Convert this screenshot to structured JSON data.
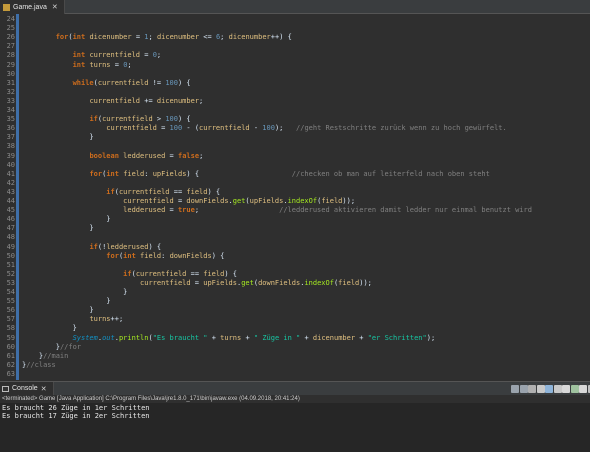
{
  "editor": {
    "tab_label": "Game.java",
    "close_glyph": "✕",
    "lines": [
      {
        "n": "24",
        "t": []
      },
      {
        "n": "25",
        "t": []
      },
      {
        "n": "26",
        "t": [
          [
            "",
            "        "
          ],
          [
            "k",
            "for"
          ],
          [
            "",
            "("
          ],
          [
            "k",
            "int"
          ],
          [
            "",
            " "
          ],
          [
            "v",
            "dicenumber"
          ],
          [
            "",
            " = "
          ],
          [
            "n",
            "1"
          ],
          [
            "",
            "; "
          ],
          [
            "v",
            "dicenumber"
          ],
          [
            "",
            " <= "
          ],
          [
            "n",
            "6"
          ],
          [
            "",
            "; "
          ],
          [
            "v",
            "dicenumber"
          ],
          [
            "",
            "++) {"
          ]
        ]
      },
      {
        "n": "27",
        "t": []
      },
      {
        "n": "28",
        "t": [
          [
            "",
            "            "
          ],
          [
            "k",
            "int"
          ],
          [
            "",
            " "
          ],
          [
            "v",
            "currentfield"
          ],
          [
            "",
            " = "
          ],
          [
            "n",
            "0"
          ],
          [
            "",
            ";"
          ]
        ]
      },
      {
        "n": "29",
        "t": [
          [
            "",
            "            "
          ],
          [
            "k",
            "int"
          ],
          [
            "",
            " "
          ],
          [
            "v",
            "turns"
          ],
          [
            "",
            " = "
          ],
          [
            "n",
            "0"
          ],
          [
            "",
            ";"
          ]
        ]
      },
      {
        "n": "30",
        "t": []
      },
      {
        "n": "31",
        "t": [
          [
            "",
            "            "
          ],
          [
            "k",
            "while"
          ],
          [
            "",
            "("
          ],
          [
            "v",
            "currentfield"
          ],
          [
            "",
            " != "
          ],
          [
            "n",
            "100"
          ],
          [
            "",
            ") {"
          ]
        ]
      },
      {
        "n": "32",
        "t": []
      },
      {
        "n": "33",
        "t": [
          [
            "",
            "                "
          ],
          [
            "v",
            "currentfield"
          ],
          [
            "",
            " += "
          ],
          [
            "v",
            "dicenumber"
          ],
          [
            "",
            ";"
          ]
        ]
      },
      {
        "n": "34",
        "t": []
      },
      {
        "n": "35",
        "t": [
          [
            "",
            "                "
          ],
          [
            "k",
            "if"
          ],
          [
            "",
            "("
          ],
          [
            "v",
            "currentfield"
          ],
          [
            "",
            " > "
          ],
          [
            "n",
            "100"
          ],
          [
            "",
            ") {"
          ]
        ]
      },
      {
        "n": "36",
        "t": [
          [
            "",
            "                    "
          ],
          [
            "v",
            "currentfield"
          ],
          [
            "",
            " = "
          ],
          [
            "n",
            "100"
          ],
          [
            "",
            " - ("
          ],
          [
            "v",
            "currentfield"
          ],
          [
            "",
            " - "
          ],
          [
            "n",
            "100"
          ],
          [
            "",
            ");   "
          ],
          [
            "c",
            "//geht Restschritte zurück wenn zu hoch gewürfelt."
          ]
        ]
      },
      {
        "n": "37",
        "t": [
          [
            "",
            "                }"
          ]
        ]
      },
      {
        "n": "38",
        "t": []
      },
      {
        "n": "39",
        "t": [
          [
            "",
            "                "
          ],
          [
            "k",
            "boolean"
          ],
          [
            "",
            " "
          ],
          [
            "v",
            "ledderused"
          ],
          [
            "",
            " = "
          ],
          [
            "k",
            "false"
          ],
          [
            "",
            ";"
          ]
        ]
      },
      {
        "n": "40",
        "t": []
      },
      {
        "n": "41",
        "t": [
          [
            "",
            "                "
          ],
          [
            "k",
            "for"
          ],
          [
            "",
            "("
          ],
          [
            "k",
            "int"
          ],
          [
            "",
            " "
          ],
          [
            "v",
            "field"
          ],
          [
            "",
            ": "
          ],
          [
            "v",
            "upFields"
          ],
          [
            "",
            ") {                      "
          ],
          [
            "c",
            "//checken ob man auf leiterfeld nach oben steht"
          ]
        ]
      },
      {
        "n": "42",
        "t": []
      },
      {
        "n": "43",
        "t": [
          [
            "",
            "                    "
          ],
          [
            "k",
            "if"
          ],
          [
            "",
            "("
          ],
          [
            "v",
            "currentfield"
          ],
          [
            "",
            " == "
          ],
          [
            "v",
            "field"
          ],
          [
            "",
            ") {"
          ]
        ]
      },
      {
        "n": "44",
        "t": [
          [
            "",
            "                        "
          ],
          [
            "v",
            "currentfield"
          ],
          [
            "",
            " = "
          ],
          [
            "v",
            "downFields"
          ],
          [
            "",
            "."
          ],
          [
            "m",
            "get"
          ],
          [
            "",
            "("
          ],
          [
            "v",
            "upFields"
          ],
          [
            "",
            "."
          ],
          [
            "m",
            "indexOf"
          ],
          [
            "",
            "("
          ],
          [
            "v",
            "field"
          ],
          [
            "",
            "));"
          ]
        ]
      },
      {
        "n": "45",
        "t": [
          [
            "",
            "                        "
          ],
          [
            "v",
            "ledderused"
          ],
          [
            "",
            " = "
          ],
          [
            "k",
            "true"
          ],
          [
            "",
            ";                   "
          ],
          [
            "c",
            "//ledderused aktivieren damit ledder nur einmal benutzt wird"
          ]
        ]
      },
      {
        "n": "46",
        "t": [
          [
            "",
            "                    }"
          ]
        ]
      },
      {
        "n": "47",
        "t": [
          [
            "",
            "                }"
          ]
        ]
      },
      {
        "n": "48",
        "t": []
      },
      {
        "n": "49",
        "t": [
          [
            "",
            "                "
          ],
          [
            "k",
            "if"
          ],
          [
            "",
            "(!"
          ],
          [
            "v",
            "ledderused"
          ],
          [
            "",
            ") {"
          ]
        ]
      },
      {
        "n": "50",
        "t": [
          [
            "",
            "                    "
          ],
          [
            "k",
            "for"
          ],
          [
            "",
            "("
          ],
          [
            "k",
            "int"
          ],
          [
            "",
            " "
          ],
          [
            "v",
            "field"
          ],
          [
            "",
            ": "
          ],
          [
            "v",
            "downFields"
          ],
          [
            "",
            ") {"
          ]
        ]
      },
      {
        "n": "51",
        "t": []
      },
      {
        "n": "52",
        "t": [
          [
            "",
            "                        "
          ],
          [
            "k",
            "if"
          ],
          [
            "",
            "("
          ],
          [
            "v",
            "currentfield"
          ],
          [
            "",
            " == "
          ],
          [
            "v",
            "field"
          ],
          [
            "",
            ") {"
          ]
        ]
      },
      {
        "n": "53",
        "t": [
          [
            "",
            "                            "
          ],
          [
            "v",
            "currentfield"
          ],
          [
            "",
            " = "
          ],
          [
            "v",
            "upFields"
          ],
          [
            "",
            "."
          ],
          [
            "m",
            "get"
          ],
          [
            "",
            "("
          ],
          [
            "v",
            "downFields"
          ],
          [
            "",
            "."
          ],
          [
            "m",
            "indexOf"
          ],
          [
            "",
            "("
          ],
          [
            "v",
            "field"
          ],
          [
            "",
            "));"
          ]
        ]
      },
      {
        "n": "54",
        "t": [
          [
            "",
            "                        }"
          ]
        ]
      },
      {
        "n": "55",
        "t": [
          [
            "",
            "                    }"
          ]
        ]
      },
      {
        "n": "56",
        "t": [
          [
            "",
            "                }"
          ]
        ]
      },
      {
        "n": "57",
        "t": [
          [
            "",
            "                "
          ],
          [
            "v",
            "turns"
          ],
          [
            "",
            "++;"
          ]
        ]
      },
      {
        "n": "58",
        "t": [
          [
            "",
            "            }"
          ]
        ]
      },
      {
        "n": "59",
        "t": [
          [
            "",
            "            "
          ],
          [
            "t",
            "System"
          ],
          [
            "",
            "."
          ],
          [
            "t",
            "out"
          ],
          [
            "",
            "."
          ],
          [
            "m",
            "println"
          ],
          [
            "",
            "("
          ],
          [
            "s",
            "\"Es braucht \""
          ],
          [
            "",
            " + "
          ],
          [
            "v",
            "turns"
          ],
          [
            "",
            " + "
          ],
          [
            "s",
            "\" Züge in \""
          ],
          [
            "",
            " + "
          ],
          [
            "v",
            "dicenumber"
          ],
          [
            "",
            " + "
          ],
          [
            "s",
            "\"er Schritten\""
          ],
          [
            "",
            ");"
          ]
        ]
      },
      {
        "n": "60",
        "t": [
          [
            "",
            "        }"
          ],
          [
            "c",
            "//for"
          ]
        ]
      },
      {
        "n": "61",
        "t": [
          [
            "",
            "    }"
          ],
          [
            "c",
            "//main"
          ]
        ]
      },
      {
        "n": "62",
        "t": [
          [
            "",
            "}"
          ],
          [
            "c",
            "//class"
          ]
        ]
      },
      {
        "n": "63",
        "t": []
      }
    ]
  },
  "console": {
    "tab_label": "Console",
    "close_glyph": "✕",
    "status": "<terminated> Game [Java Application] C:\\Program Files\\Java\\jre1.8.0_171\\bin\\javaw.exe (04.09.2018, 20:41:24)",
    "output": [
      "Es braucht 26 Züge in 1er Schritten",
      "Es braucht 17 Züge in 2er Schritten"
    ],
    "toolbar_icons": [
      "terminate-icon",
      "remove-launch-icon",
      "remove-all-icon",
      "clear-console-icon",
      "scroll-lock-icon",
      "word-wrap-icon",
      "pin-console-icon",
      "display-console-icon",
      "open-console-icon",
      "minimize-icon"
    ]
  },
  "colors": {
    "background": "#2f2f2f",
    "keyword": "#cc6c1d",
    "variable": "#e0c080",
    "number": "#6897bb",
    "string": "#17c6a3",
    "comment": "#808080",
    "method": "#a7ec21",
    "fold_bar": "#3f6fa8"
  }
}
